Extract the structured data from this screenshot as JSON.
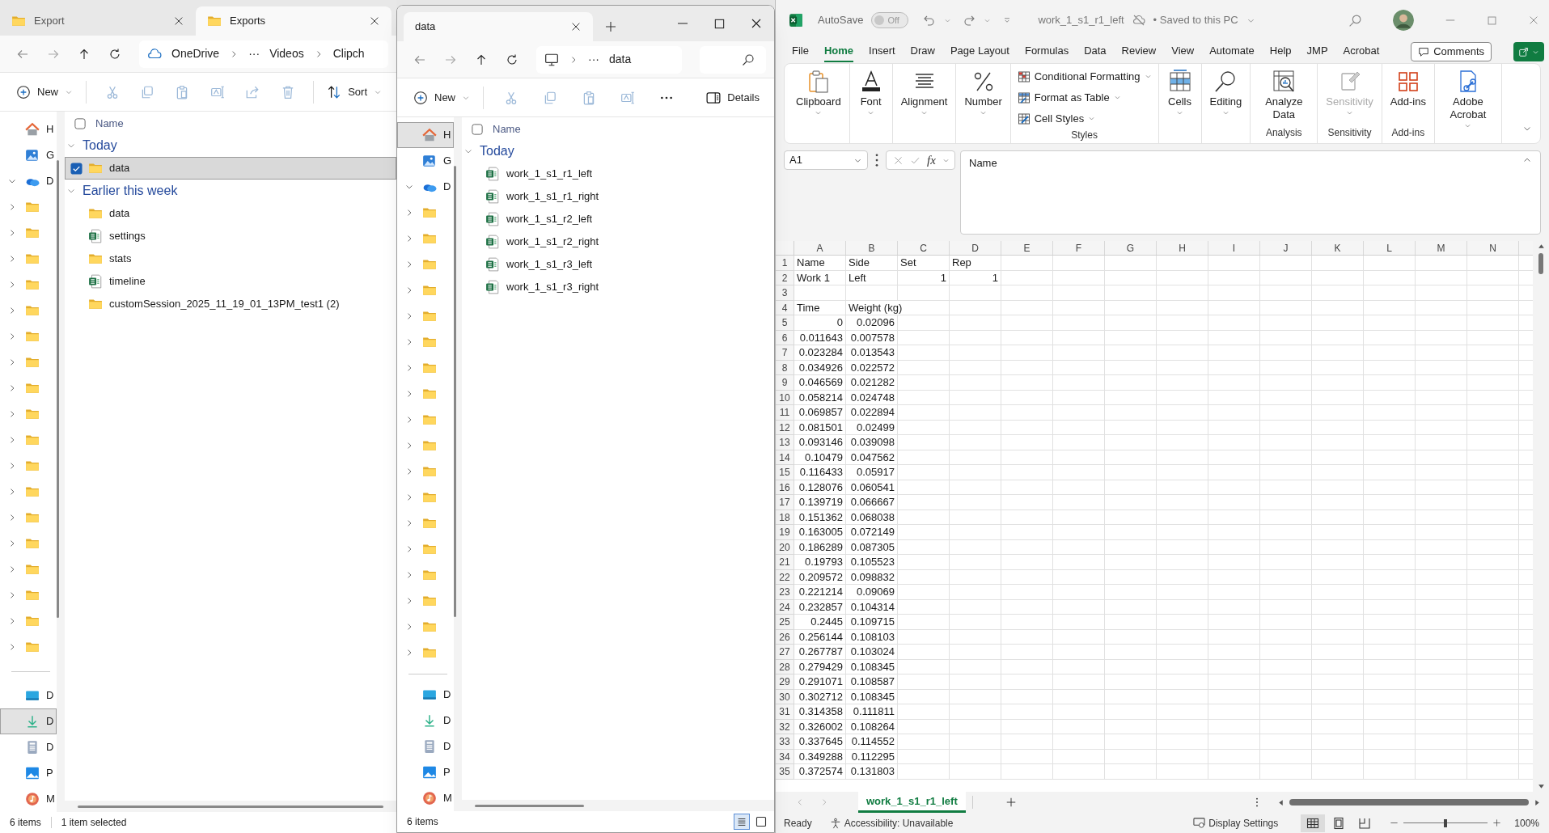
{
  "explorers": [
    {
      "kind": "back",
      "tabs": [
        {
          "label": "Export",
          "selected": false
        },
        {
          "label": "Exports",
          "selected": true
        }
      ],
      "address": [
        {
          "kind": "onedrive",
          "label": "OneDrive"
        },
        {
          "kind": "more",
          "label": "···"
        },
        {
          "kind": "folder",
          "label": "Videos"
        },
        {
          "kind": "folder",
          "label": "Clipch"
        }
      ],
      "commands": [
        {
          "kind": "new",
          "label": "New",
          "disabled": false
        },
        {
          "kind": "cut",
          "disabled": true
        },
        {
          "kind": "copy",
          "disabled": true
        },
        {
          "kind": "paste",
          "disabled": true
        },
        {
          "kind": "rename",
          "disabled": true
        },
        {
          "kind": "share",
          "disabled": true
        },
        {
          "kind": "delete",
          "disabled": true
        },
        {
          "kind": "sort",
          "label": "Sort",
          "disabled": false
        }
      ],
      "nav": [
        {
          "kind": "home",
          "label": "H",
          "selected": false
        },
        {
          "kind": "gallery",
          "label": "G",
          "selected": false
        },
        {
          "kind": "onedrive",
          "label": "D",
          "expanded": true,
          "selected": false,
          "children": [
            {
              "kind": "folder",
              "expanded": false,
              "selected": false
            },
            {
              "kind": "folder",
              "expanded": false,
              "selected": false
            },
            {
              "kind": "folder",
              "expanded": false,
              "selected": false
            },
            {
              "kind": "folder",
              "expanded": false,
              "selected": false
            },
            {
              "kind": "folder",
              "expanded": false,
              "selected": false
            },
            {
              "kind": "folder",
              "expanded": false,
              "selected": false
            },
            {
              "kind": "folder",
              "expanded": false,
              "selected": false
            },
            {
              "kind": "folder",
              "expanded": false,
              "selected": false
            },
            {
              "kind": "folder",
              "expanded": false,
              "selected": false
            },
            {
              "kind": "folder",
              "expanded": false,
              "selected": false
            },
            {
              "kind": "folder",
              "expanded": false,
              "selected": false
            },
            {
              "kind": "folder",
              "expanded": false,
              "selected": false
            },
            {
              "kind": "folder",
              "expanded": false,
              "selected": false
            },
            {
              "kind": "folder",
              "expanded": false,
              "selected": false
            },
            {
              "kind": "folder",
              "expanded": false,
              "selected": false
            },
            {
              "kind": "folder",
              "expanded": false,
              "selected": false
            },
            {
              "kind": "folder",
              "expanded": false,
              "selected": false
            },
            {
              "kind": "folder",
              "expanded": false,
              "selected": false
            }
          ]
        },
        {
          "kind": "separator"
        },
        {
          "kind": "desktop",
          "label": "D",
          "selected": false
        },
        {
          "kind": "downloads",
          "label": "D",
          "selected": true
        },
        {
          "kind": "documents",
          "label": "D",
          "selected": false
        },
        {
          "kind": "pictures",
          "label": "P",
          "selected": false
        },
        {
          "kind": "music",
          "label": "M",
          "selected": false
        }
      ],
      "column_header": "Name",
      "groups": [
        {
          "label": "Today",
          "expanded": true,
          "items": [
            {
              "name": "data",
              "kind": "folder",
              "selected": true
            }
          ]
        },
        {
          "label": "Earlier this week",
          "expanded": true,
          "items": [
            {
              "name": "data",
              "kind": "folder",
              "selected": false
            },
            {
              "name": "settings",
              "kind": "spreadsheet",
              "selected": false
            },
            {
              "name": "stats",
              "kind": "folder",
              "selected": false
            },
            {
              "name": "timeline",
              "kind": "spreadsheet",
              "selected": false
            },
            {
              "name": "customSession_2025_11_19_01_13PM_test1 (2)",
              "kind": "folder",
              "selected": false
            }
          ]
        }
      ],
      "status": [
        "6 items",
        "1 item selected"
      ]
    },
    {
      "kind": "front",
      "tabs": [
        {
          "label": "data",
          "selected": true
        }
      ],
      "address": [
        {
          "kind": "computer"
        },
        {
          "kind": "more",
          "label": "···"
        },
        {
          "kind": "folder",
          "label": "data"
        }
      ],
      "search_field": true,
      "commands": [
        {
          "kind": "new",
          "label": "New",
          "disabled": false
        },
        {
          "kind": "cut",
          "disabled": true
        },
        {
          "kind": "copy",
          "disabled": true
        },
        {
          "kind": "paste",
          "disabled": true
        },
        {
          "kind": "rename",
          "disabled": true
        },
        {
          "kind": "more",
          "disabled": false
        },
        {
          "kind": "details",
          "label": "Details",
          "disabled": false
        }
      ],
      "nav": [
        {
          "kind": "home",
          "label": "H",
          "selected": true
        },
        {
          "kind": "gallery",
          "label": "G",
          "selected": false
        },
        {
          "kind": "onedrive",
          "label": "D",
          "expanded": true,
          "selected": false,
          "children": [
            {
              "kind": "folder",
              "expanded": false,
              "selected": false
            },
            {
              "kind": "folder",
              "expanded": false,
              "selected": false
            },
            {
              "kind": "folder",
              "expanded": false,
              "selected": false
            },
            {
              "kind": "folder",
              "expanded": false,
              "selected": false
            },
            {
              "kind": "folder",
              "expanded": false,
              "selected": false
            },
            {
              "kind": "folder",
              "expanded": false,
              "selected": false
            },
            {
              "kind": "folder",
              "expanded": false,
              "selected": false
            },
            {
              "kind": "folder",
              "expanded": false,
              "selected": false
            },
            {
              "kind": "folder",
              "expanded": false,
              "selected": false
            },
            {
              "kind": "folder",
              "expanded": false,
              "selected": false
            },
            {
              "kind": "folder",
              "expanded": false,
              "selected": false
            },
            {
              "kind": "folder",
              "expanded": false,
              "selected": false
            },
            {
              "kind": "folder",
              "expanded": false,
              "selected": false
            },
            {
              "kind": "folder",
              "expanded": false,
              "selected": false
            },
            {
              "kind": "folder",
              "expanded": false,
              "selected": false
            },
            {
              "kind": "folder",
              "expanded": false,
              "selected": false
            },
            {
              "kind": "folder",
              "expanded": false,
              "selected": false
            },
            {
              "kind": "folder",
              "expanded": false,
              "selected": false
            }
          ]
        },
        {
          "kind": "separator"
        },
        {
          "kind": "desktop",
          "label": "D",
          "selected": false
        },
        {
          "kind": "downloads",
          "label": "D",
          "selected": false
        },
        {
          "kind": "documents",
          "label": "D",
          "selected": false
        },
        {
          "kind": "pictures",
          "label": "P",
          "selected": false
        },
        {
          "kind": "music",
          "label": "M",
          "selected": false
        }
      ],
      "column_header": "Name",
      "groups": [
        {
          "label": "Today",
          "expanded": true,
          "items": [
            {
              "name": "work_1_s1_r1_left",
              "kind": "spreadsheet",
              "selected": false
            },
            {
              "name": "work_1_s1_r1_right",
              "kind": "spreadsheet",
              "selected": false
            },
            {
              "name": "work_1_s1_r2_left",
              "kind": "spreadsheet",
              "selected": false
            },
            {
              "name": "work_1_s1_r2_right",
              "kind": "spreadsheet",
              "selected": false
            },
            {
              "name": "work_1_s1_r3_left",
              "kind": "spreadsheet",
              "selected": false
            },
            {
              "name": "work_1_s1_r3_right",
              "kind": "spreadsheet",
              "selected": false
            }
          ]
        }
      ],
      "status": [
        "6 items"
      ],
      "views": [
        {
          "kind": "details",
          "selected": true
        },
        {
          "kind": "tiles",
          "selected": false
        }
      ]
    }
  ],
  "excel": {
    "title_bar": {
      "autosave_label": "AutoSave",
      "autosave": {
        "on": false,
        "label": "Off"
      },
      "file_name": "work_1_s1_r1_left",
      "save_status": "• Saved to this PC"
    },
    "menu": [
      {
        "label": "File",
        "selected": false
      },
      {
        "label": "Home",
        "selected": true
      },
      {
        "label": "Insert",
        "selected": false
      },
      {
        "label": "Draw",
        "selected": false
      },
      {
        "label": "Page Layout",
        "selected": false
      },
      {
        "label": "Formulas",
        "selected": false
      },
      {
        "label": "Data",
        "selected": false
      },
      {
        "label": "Review",
        "selected": false
      },
      {
        "label": "View",
        "selected": false
      },
      {
        "label": "Automate",
        "selected": false
      },
      {
        "label": "Help",
        "selected": false
      },
      {
        "label": "JMP",
        "selected": false
      },
      {
        "label": "Acrobat",
        "selected": false
      }
    ],
    "comments_button": "Comments",
    "ribbon": [
      {
        "kind": "clipboard",
        "label": "Clipboard",
        "dropdown": true,
        "disabled": false
      },
      {
        "kind": "font",
        "label": "Font",
        "dropdown": true,
        "disabled": false
      },
      {
        "kind": "alignment",
        "label": "Alignment",
        "dropdown": true,
        "disabled": false
      },
      {
        "kind": "number",
        "label": "Number",
        "dropdown": true,
        "disabled": false
      },
      {
        "kind": "styles",
        "commands": [
          "Conditional Formatting",
          "Format as Table",
          "Cell Styles"
        ],
        "group": "Styles"
      },
      {
        "kind": "cells",
        "label": "Cells",
        "dropdown": true,
        "disabled": false
      },
      {
        "kind": "editing",
        "label": "Editing",
        "dropdown": true,
        "disabled": false
      },
      {
        "kind": "analyze",
        "label": "Analyze Data",
        "dropdown": false,
        "disabled": false,
        "group": "Analysis"
      },
      {
        "kind": "sensitivity",
        "label": "Sensitivity",
        "dropdown": true,
        "disabled": true,
        "group": "Sensitivity"
      },
      {
        "kind": "addins",
        "label": "Add-ins",
        "dropdown": false,
        "disabled": false,
        "group": "Add-ins"
      },
      {
        "kind": "acrobat",
        "label": "Adobe Acrobat",
        "dropdown": true,
        "disabled": false
      }
    ],
    "name_box": "A1",
    "function_label": "fx",
    "formula": "Name",
    "columns": [
      "A",
      "B",
      "C",
      "D",
      "E",
      "F",
      "G",
      "H",
      "I",
      "J",
      "K",
      "L",
      "M",
      "N"
    ],
    "rows": [
      {
        "number": "1",
        "cells": [
          {
            "value": "Name",
            "kind": "text"
          },
          {
            "value": "Side",
            "kind": "text"
          },
          {
            "value": "Set",
            "kind": "text"
          },
          {
            "value": "Rep",
            "kind": "text"
          }
        ]
      },
      {
        "number": "2",
        "cells": [
          {
            "value": "Work 1",
            "kind": "text"
          },
          {
            "value": "Left",
            "kind": "text"
          },
          {
            "value": "1",
            "kind": "number"
          },
          {
            "value": "1",
            "kind": "number"
          }
        ]
      },
      {
        "number": "3",
        "cells": []
      },
      {
        "number": "4",
        "cells": [
          {
            "value": "Time",
            "kind": "text"
          },
          {
            "value": "Weight (kg)",
            "kind": "text"
          }
        ]
      },
      {
        "number": "5",
        "cells": [
          {
            "value": "0",
            "kind": "number"
          },
          {
            "value": "0.02096",
            "kind": "number"
          }
        ]
      },
      {
        "number": "6",
        "cells": [
          {
            "value": "0.011643",
            "kind": "number"
          },
          {
            "value": "0.007578",
            "kind": "number"
          }
        ]
      },
      {
        "number": "7",
        "cells": [
          {
            "value": "0.023284",
            "kind": "number"
          },
          {
            "value": "0.013543",
            "kind": "number"
          }
        ]
      },
      {
        "number": "8",
        "cells": [
          {
            "value": "0.034926",
            "kind": "number"
          },
          {
            "value": "0.022572",
            "kind": "number"
          }
        ]
      },
      {
        "number": "9",
        "cells": [
          {
            "value": "0.046569",
            "kind": "number"
          },
          {
            "value": "0.021282",
            "kind": "number"
          }
        ]
      },
      {
        "number": "10",
        "cells": [
          {
            "value": "0.058214",
            "kind": "number"
          },
          {
            "value": "0.024748",
            "kind": "number"
          }
        ]
      },
      {
        "number": "11",
        "cells": [
          {
            "value": "0.069857",
            "kind": "number"
          },
          {
            "value": "0.022894",
            "kind": "number"
          }
        ]
      },
      {
        "number": "12",
        "cells": [
          {
            "value": "0.081501",
            "kind": "number"
          },
          {
            "value": "0.02499",
            "kind": "number"
          }
        ]
      },
      {
        "number": "13",
        "cells": [
          {
            "value": "0.093146",
            "kind": "number"
          },
          {
            "value": "0.039098",
            "kind": "number"
          }
        ]
      },
      {
        "number": "14",
        "cells": [
          {
            "value": "0.10479",
            "kind": "number"
          },
          {
            "value": "0.047562",
            "kind": "number"
          }
        ]
      },
      {
        "number": "15",
        "cells": [
          {
            "value": "0.116433",
            "kind": "number"
          },
          {
            "value": "0.05917",
            "kind": "number"
          }
        ]
      },
      {
        "number": "16",
        "cells": [
          {
            "value": "0.128076",
            "kind": "number"
          },
          {
            "value": "0.060541",
            "kind": "number"
          }
        ]
      },
      {
        "number": "17",
        "cells": [
          {
            "value": "0.139719",
            "kind": "number"
          },
          {
            "value": "0.066667",
            "kind": "number"
          }
        ]
      },
      {
        "number": "18",
        "cells": [
          {
            "value": "0.151362",
            "kind": "number"
          },
          {
            "value": "0.068038",
            "kind": "number"
          }
        ]
      },
      {
        "number": "19",
        "cells": [
          {
            "value": "0.163005",
            "kind": "number"
          },
          {
            "value": "0.072149",
            "kind": "number"
          }
        ]
      },
      {
        "number": "20",
        "cells": [
          {
            "value": "0.186289",
            "kind": "number"
          },
          {
            "value": "0.087305",
            "kind": "number"
          }
        ]
      },
      {
        "number": "21",
        "cells": [
          {
            "value": "0.19793",
            "kind": "number"
          },
          {
            "value": "0.105523",
            "kind": "number"
          }
        ]
      },
      {
        "number": "22",
        "cells": [
          {
            "value": "0.209572",
            "kind": "number"
          },
          {
            "value": "0.098832",
            "kind": "number"
          }
        ]
      },
      {
        "number": "23",
        "cells": [
          {
            "value": "0.221214",
            "kind": "number"
          },
          {
            "value": "0.09069",
            "kind": "number"
          }
        ]
      },
      {
        "number": "24",
        "cells": [
          {
            "value": "0.232857",
            "kind": "number"
          },
          {
            "value": "0.104314",
            "kind": "number"
          }
        ]
      },
      {
        "number": "25",
        "cells": [
          {
            "value": "0.2445",
            "kind": "number"
          },
          {
            "value": "0.109715",
            "kind": "number"
          }
        ]
      },
      {
        "number": "26",
        "cells": [
          {
            "value": "0.256144",
            "kind": "number"
          },
          {
            "value": "0.108103",
            "kind": "number"
          }
        ]
      },
      {
        "number": "27",
        "cells": [
          {
            "value": "0.267787",
            "kind": "number"
          },
          {
            "value": "0.103024",
            "kind": "number"
          }
        ]
      },
      {
        "number": "28",
        "cells": [
          {
            "value": "0.279429",
            "kind": "number"
          },
          {
            "value": "0.108345",
            "kind": "number"
          }
        ]
      },
      {
        "number": "29",
        "cells": [
          {
            "value": "0.291071",
            "kind": "number"
          },
          {
            "value": "0.108587",
            "kind": "number"
          }
        ]
      },
      {
        "number": "30",
        "cells": [
          {
            "value": "0.302712",
            "kind": "number"
          },
          {
            "value": "0.108345",
            "kind": "number"
          }
        ]
      },
      {
        "number": "31",
        "cells": [
          {
            "value": "0.314358",
            "kind": "number"
          },
          {
            "value": "0.111811",
            "kind": "number"
          }
        ]
      },
      {
        "number": "32",
        "cells": [
          {
            "value": "0.326002",
            "kind": "number"
          },
          {
            "value": "0.108264",
            "kind": "number"
          }
        ]
      },
      {
        "number": "33",
        "cells": [
          {
            "value": "0.337645",
            "kind": "number"
          },
          {
            "value": "0.114552",
            "kind": "number"
          }
        ]
      },
      {
        "number": "34",
        "cells": [
          {
            "value": "0.349288",
            "kind": "number"
          },
          {
            "value": "0.112295",
            "kind": "number"
          }
        ]
      },
      {
        "number": "35",
        "cells": [
          {
            "value": "0.372574",
            "kind": "number"
          },
          {
            "value": "0.131803",
            "kind": "number"
          }
        ]
      }
    ],
    "sheets": [
      {
        "label": "work_1_s1_r1_left",
        "selected": true
      }
    ],
    "status": {
      "ready": "Ready",
      "accessibility": "Accessibility: Unavailable",
      "display_settings": "Display Settings",
      "views": [
        {
          "kind": "normal",
          "selected": true
        },
        {
          "kind": "page_layout",
          "selected": false
        },
        {
          "kind": "page_break",
          "selected": false
        }
      ],
      "zoom_slider": {
        "level": 0.5
      },
      "zoom": "100%"
    }
  }
}
